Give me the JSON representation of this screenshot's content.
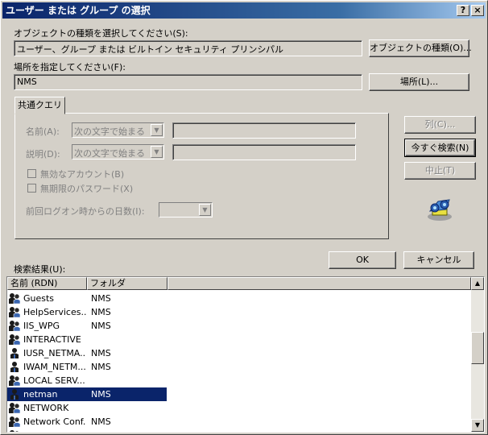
{
  "window": {
    "title": "ユーザー または グループ の選択",
    "help_label": "?",
    "close_label": "×"
  },
  "object_type": {
    "label": "オブジェクトの種類を選択してください(S):",
    "value": "ユーザー、グループ または ビルトイン セキュリティ プリンシパル",
    "button": "オブジェクトの種類(O)..."
  },
  "location": {
    "label": "場所を指定してください(F):",
    "value": "NMS",
    "button": "場所(L)..."
  },
  "query": {
    "tab": "共通クエリ",
    "name_label": "名前(A):",
    "name_mode": "次の文字で始まる",
    "desc_label": "説明(D):",
    "desc_mode": "次の文字で始まる",
    "disabled_accounts": "無効なアカウント(B)",
    "no_expire_password": "無期限のパスワード(X)",
    "days_since_logon": "前回ログオン時からの日数(I):"
  },
  "side_buttons": {
    "columns": "列(C)...",
    "search_now": "今すぐ検索(N)",
    "stop": "中止(T)"
  },
  "icons": {
    "search": "search-binoculars-icon",
    "group": "group-users-icon",
    "user": "user-icon"
  },
  "ok": "OK",
  "cancel": "キャンセル",
  "results": {
    "label": "検索結果(U):",
    "columns": [
      "名前 (RDN)",
      "フォルダ"
    ],
    "rows": [
      {
        "name": "Guests",
        "folder": "NMS",
        "type": "group"
      },
      {
        "name": "HelpServices...",
        "folder": "NMS",
        "type": "group"
      },
      {
        "name": "IIS_WPG",
        "folder": "NMS",
        "type": "group"
      },
      {
        "name": "INTERACTIVE",
        "folder": "",
        "type": "group"
      },
      {
        "name": "IUSR_NETMA...",
        "folder": "NMS",
        "type": "user"
      },
      {
        "name": "IWAM_NETM...",
        "folder": "NMS",
        "type": "user"
      },
      {
        "name": "LOCAL SERV...",
        "folder": "",
        "type": "group"
      },
      {
        "name": "netman",
        "folder": "NMS",
        "type": "user",
        "selected": true
      },
      {
        "name": "NETWORK",
        "folder": "",
        "type": "group"
      },
      {
        "name": "Network Conf...",
        "folder": "NMS",
        "type": "group"
      },
      {
        "name": "NETWORK S...",
        "folder": "",
        "type": "group"
      }
    ]
  }
}
